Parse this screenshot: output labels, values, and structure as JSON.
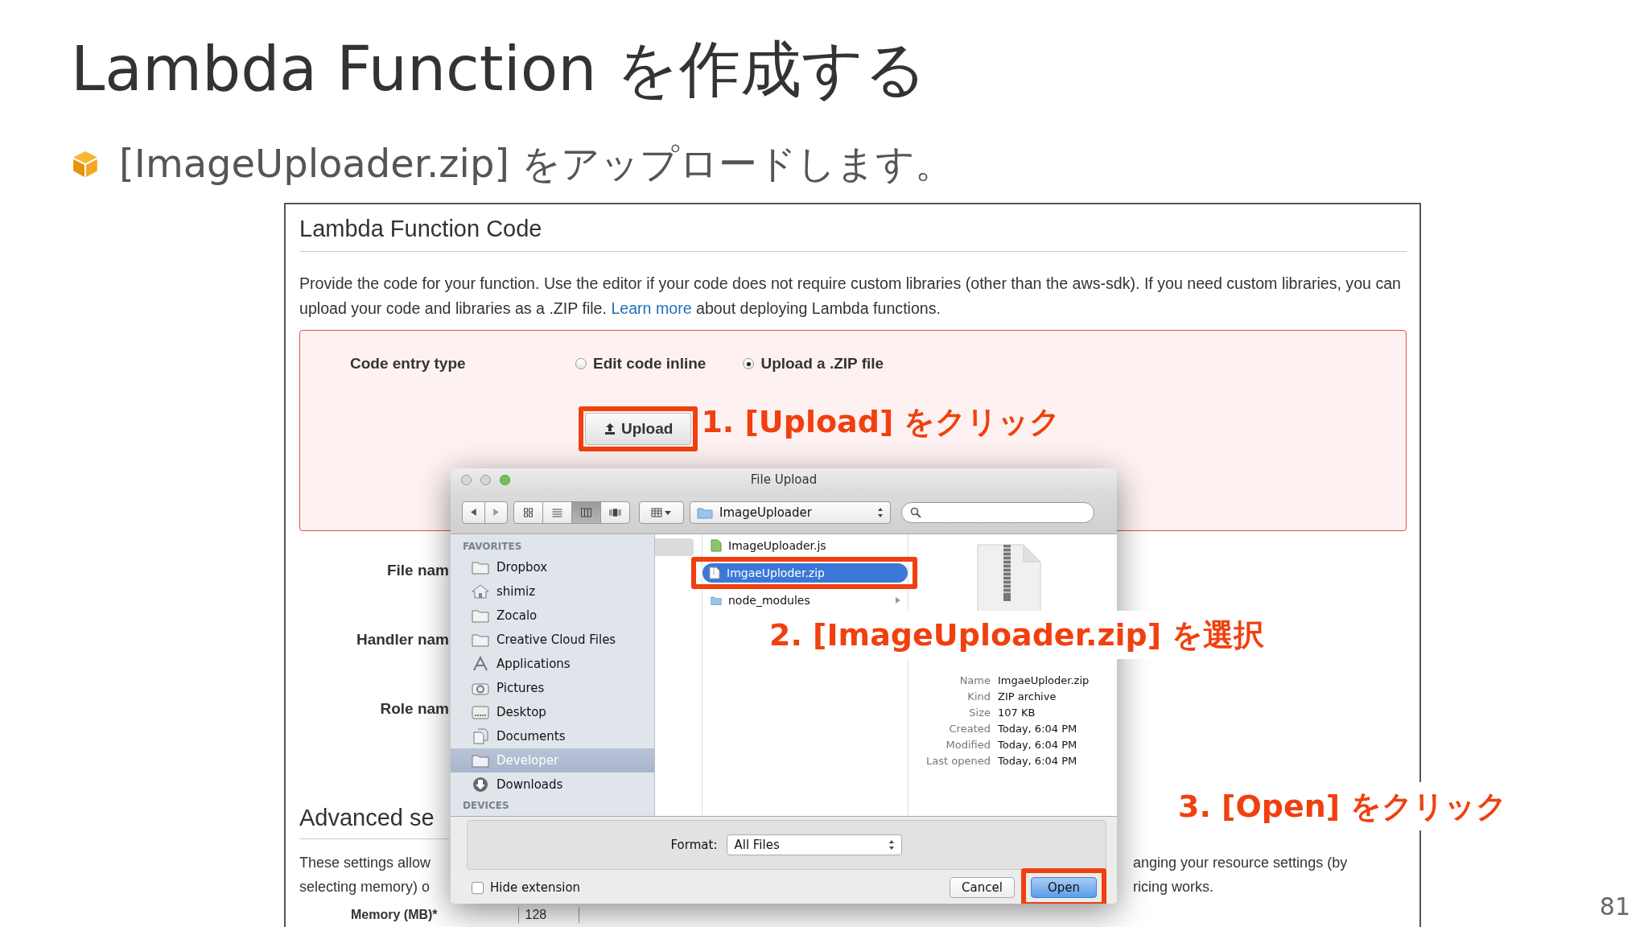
{
  "slide": {
    "title": "Lambda Function を作成する",
    "bullet": "[ImageUploader.zip] をアップロードします。",
    "page_number": "81"
  },
  "console": {
    "section_title": "Lambda Function Code",
    "description": {
      "before": "Provide the code for your function. Use the editor if your code does not require custom libraries (other than the aws-sdk). If you need custom libraries, you can upload your code and libraries as a .ZIP file.",
      "link": "Learn more",
      "after": "about deploying Lambda functions."
    },
    "code_entry": {
      "label": "Code entry type",
      "upload_button": "Upload",
      "options": [
        {
          "label": "Edit code inline",
          "selected": false
        },
        {
          "label": "Upload a .ZIP file",
          "selected": true
        }
      ]
    },
    "fields": [
      {
        "label": "File nam"
      },
      {
        "label": "Handler nam"
      },
      {
        "label": "Role nam"
      }
    ],
    "advanced": {
      "title": "Advanced se",
      "text_left": [
        "These settings allow",
        "selecting memory) o"
      ],
      "text_right": [
        "anging your resource settings (by",
        "ricing works."
      ],
      "memory_label": "Memory (MB)*",
      "memory_value": "128"
    }
  },
  "dialog": {
    "title": "File Upload",
    "location": "ImageUploader",
    "view_modes": [
      {
        "kind": "icons",
        "selected": false
      },
      {
        "kind": "list",
        "selected": false
      },
      {
        "kind": "columns",
        "selected": true
      },
      {
        "kind": "coverflow",
        "selected": false
      }
    ],
    "sidebar_heading": "FAVORITES",
    "sidebar": [
      {
        "label": "Dropbox",
        "kind": "folder",
        "selected": false
      },
      {
        "label": "shimiz",
        "kind": "home",
        "selected": false
      },
      {
        "label": "Zocalo",
        "kind": "folder",
        "selected": false
      },
      {
        "label": "Creative Cloud Files",
        "kind": "folder",
        "selected": false
      },
      {
        "label": "Applications",
        "kind": "apps",
        "selected": false
      },
      {
        "label": "Pictures",
        "kind": "camera",
        "selected": false
      },
      {
        "label": "Desktop",
        "kind": "desktop",
        "selected": false
      },
      {
        "label": "Documents",
        "kind": "documents",
        "selected": false
      },
      {
        "label": "Developer",
        "kind": "folder",
        "selected": true
      },
      {
        "label": "Downloads",
        "kind": "download",
        "selected": false
      }
    ],
    "devices_heading": "DEVICES",
    "files": [
      {
        "name": "ImageUploader.js",
        "kind": "script",
        "selected": false
      },
      {
        "name": "ImgaeUploder.zip",
        "kind": "zip",
        "selected": true
      },
      {
        "name": "node_modules",
        "kind": "folder",
        "selected": false
      }
    ],
    "preview": [
      {
        "label": "Name",
        "value": "ImgaeUploder.zip"
      },
      {
        "label": "Kind",
        "value": "ZIP archive"
      },
      {
        "label": "Size",
        "value": "107 KB"
      },
      {
        "label": "Created",
        "value": "Today, 6:04 PM"
      },
      {
        "label": "Modified",
        "value": "Today, 6:04 PM"
      },
      {
        "label": "Last opened",
        "value": "Today, 6:04 PM"
      }
    ],
    "format": {
      "label": "Format:",
      "value": "All Files"
    },
    "hide_extension": {
      "label": "Hide extension",
      "checked": false
    },
    "buttons": [
      {
        "label": "Cancel",
        "default": false
      },
      {
        "label": "Open",
        "default": true
      }
    ]
  },
  "annotations": [
    {
      "text": "1. [Upload] をクリック"
    },
    {
      "text": "2. [ImageUploader.zip] を選択"
    },
    {
      "text": "3. [Open] をクリック"
    }
  ]
}
